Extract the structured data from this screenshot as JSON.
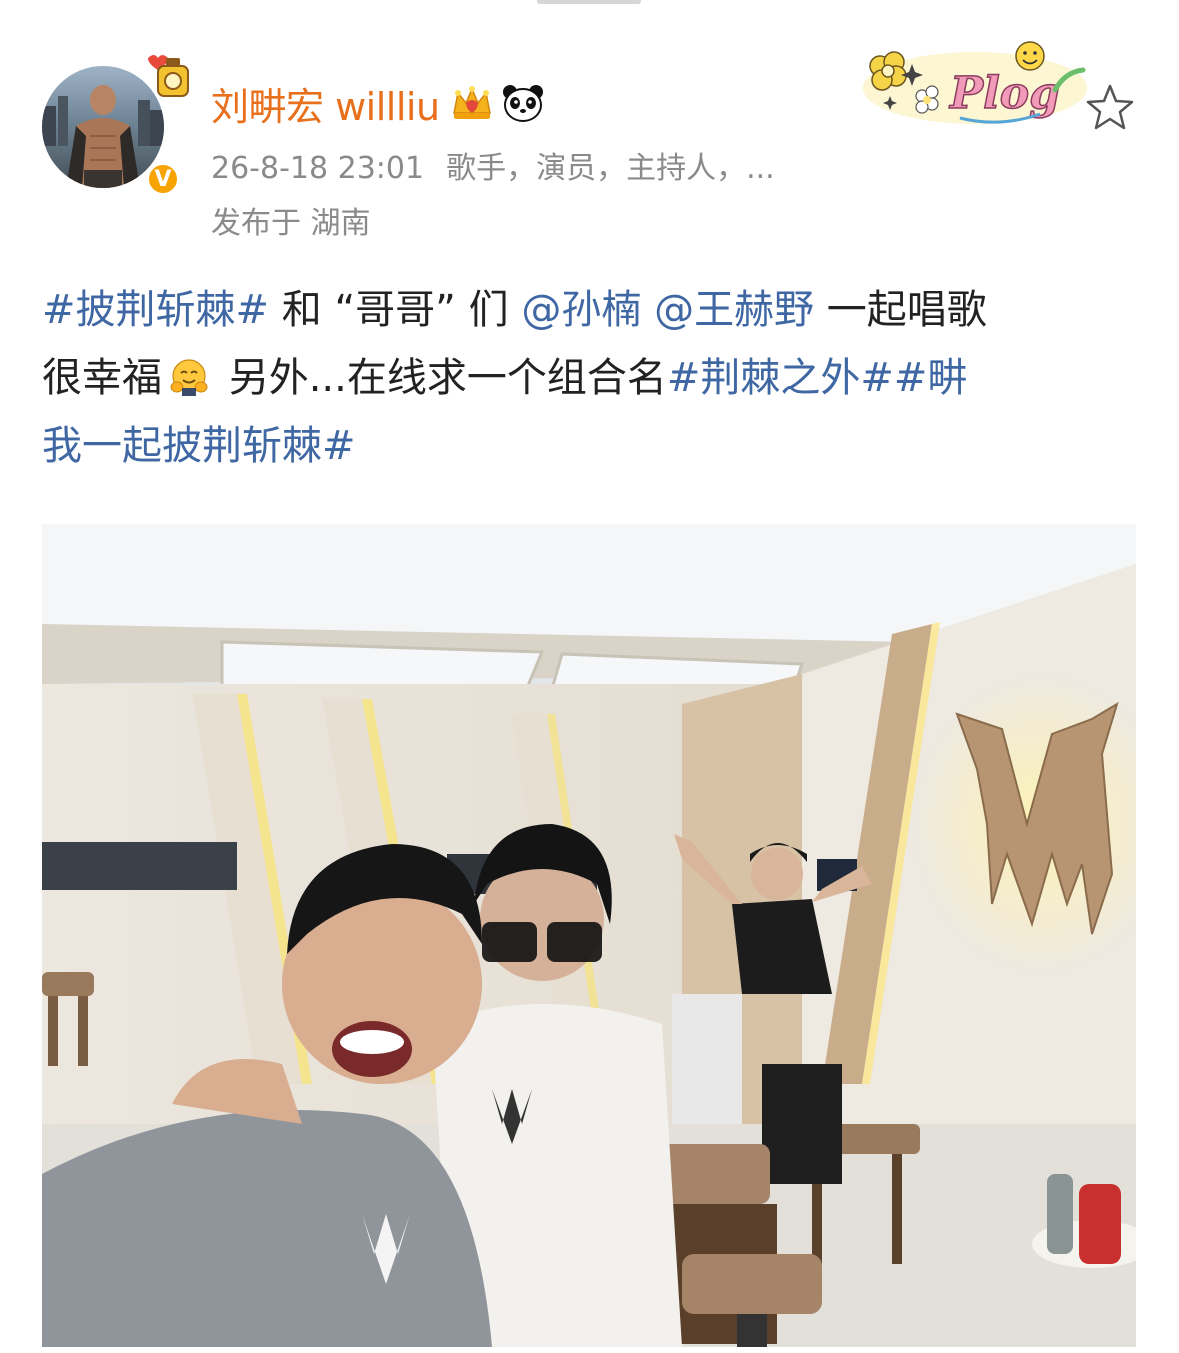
{
  "post": {
    "author": {
      "name": "刘畊宏 willliu",
      "verified_mark": "V"
    },
    "meta": {
      "time": "26-8-18 23:01",
      "roles": "歌手，演员，主持人，...",
      "location": "发布于 湖南"
    },
    "sticker_text": "Plog",
    "content": {
      "line1": {
        "hashtag1": "#披荆斩棘#",
        "text1": " 和 “哥哥” 们 ",
        "mention1": "@孙楠",
        "mention2": "@王赫野",
        "text2": " 一起唱歌"
      },
      "line2": {
        "text1": "很幸福",
        "emoji": "hug-emoji",
        "text2": " 另外...在线求一个组合名",
        "hashtag2": "#荆棘之外#",
        "hashtag3_part1": "#畊"
      },
      "line3": {
        "hashtag3_part2": "我一起披荆斩棘#"
      }
    },
    "photo_subject": "M"
  },
  "colors": {
    "author_name": "#e86f1c",
    "link": "#3f67a3",
    "meta": "#8a8a8a",
    "badge": "#f7a300"
  },
  "icons": [
    "crown-icon",
    "panda-icon",
    "star-outline-icon",
    "hug-emoji",
    "verified-icon"
  ]
}
